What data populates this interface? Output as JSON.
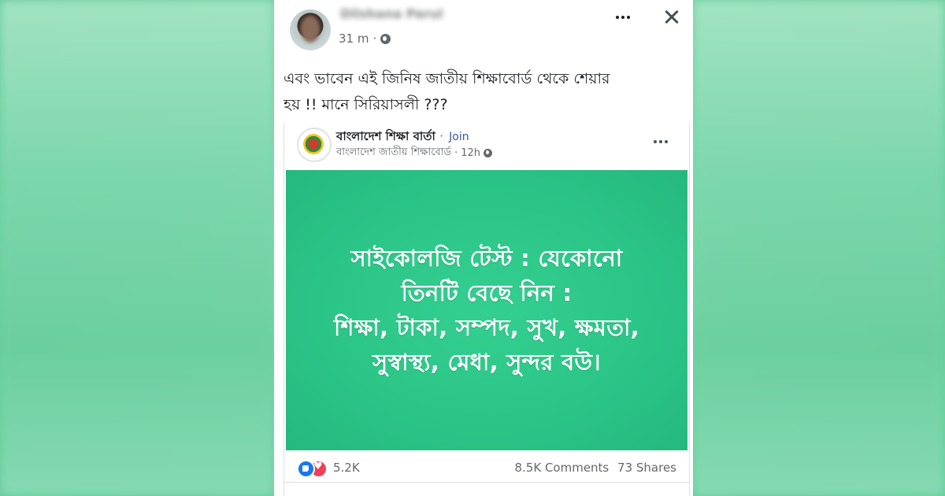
{
  "post": {
    "author": "Dilshana Parul",
    "time": "31 m",
    "separator": "·",
    "text_lines": [
      "এবং ভাবেন এই জিনিষ জাতীয় শিক্ষাবোর্ড থেকে শেয়ার",
      "হয় !! মানে সিরিয়াসলী ???"
    ]
  },
  "shared": {
    "page_name": "বাংলাদেশ শিক্ষা বার্তা",
    "join": "Join",
    "separator": "·",
    "sub_source": "বাংলাদেশ জাতীয় শিক্ষাবোর্ড",
    "sub_time": "12h",
    "card_lines": [
      "সাইকোলজি টেস্ট : যেকোনো",
      "তিনটি বেছে নিন :",
      "শিক্ষা, টাকা, সম্পদ, সুখ, ক্ষমতা,",
      "সুস্বাস্থ্য, মেধা, সুন্দর বউ।"
    ],
    "reactions_count": "5.2K",
    "comments": "8.5K Comments",
    "shares": "73 Shares"
  }
}
